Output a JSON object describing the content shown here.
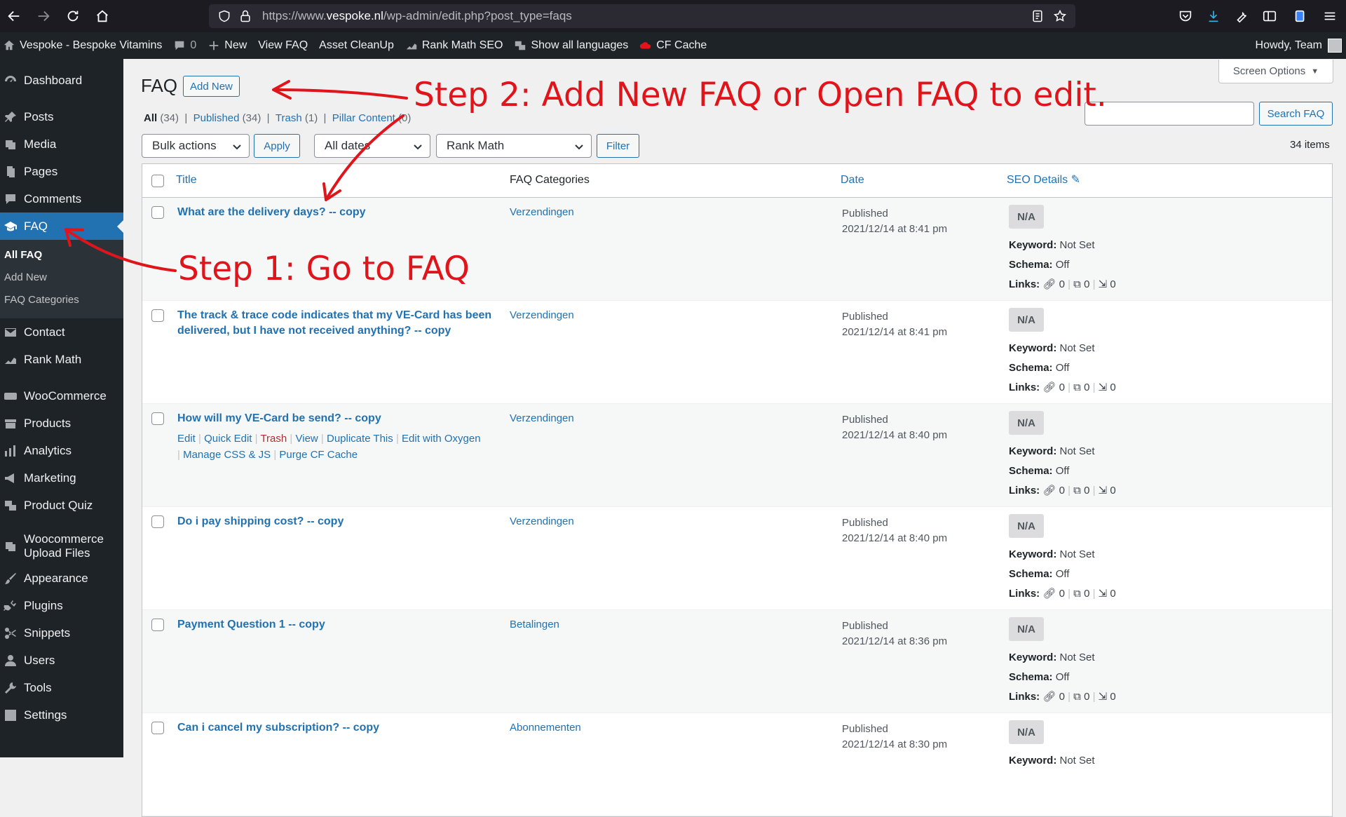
{
  "browser": {
    "url_prefix": "https://www.",
    "url_host": "vespoke.nl",
    "url_path": "/wp-admin/edit.php?post_type=faqs"
  },
  "adminbar": {
    "site_name": "Vespoke - Bespoke Vitamins",
    "comments_count": "0",
    "new_label": "New",
    "view_faq": "View FAQ",
    "asset_cleanup": "Asset CleanUp",
    "rank_math_seo": "Rank Math SEO",
    "show_languages": "Show all languages",
    "cf_cache": "CF Cache",
    "howdy": "Howdy, Team"
  },
  "sidebar": {
    "dashboard": "Dashboard",
    "posts": "Posts",
    "media": "Media",
    "pages": "Pages",
    "comments": "Comments",
    "faq": "FAQ",
    "all_faq": "All FAQ",
    "add_new": "Add New",
    "faq_categories": "FAQ Categories",
    "contact": "Contact",
    "rank_math": "Rank Math",
    "woocommerce": "WooCommerce",
    "products": "Products",
    "analytics": "Analytics",
    "marketing": "Marketing",
    "product_quiz": "Product Quiz",
    "wc_upload_1": "Woocommerce",
    "wc_upload_2": "Upload Files",
    "appearance": "Appearance",
    "plugins": "Plugins",
    "snippets": "Snippets",
    "users": "Users",
    "tools": "Tools",
    "settings": "Settings"
  },
  "page": {
    "title": "FAQ",
    "add_new": "Add New",
    "screen_options": "Screen Options",
    "filters": {
      "all": "All",
      "all_count": " (34)",
      "published": "Published",
      "published_count": " (34)",
      "trash": "Trash",
      "trash_count": " (1)",
      "pillar": "Pillar Content",
      "pillar_count": " (0)",
      "sep": "  |  "
    },
    "search_button": "Search FAQ",
    "bulk_actions": "Bulk actions",
    "apply": "Apply",
    "all_dates": "All dates",
    "rank_math": "Rank Math",
    "filter": "Filter",
    "items_count": "34 items"
  },
  "table": {
    "col_title": "Title",
    "col_categories": "FAQ Categories",
    "col_date": "Date",
    "col_seo": "SEO Details",
    "seo_na": "N/A",
    "keyword_label": "Keyword:",
    "keyword_value": " Not Set",
    "schema_label": "Schema:",
    "schema_value": " Off",
    "links_label": "Links:",
    "link_count": "0",
    "row_actions": {
      "edit": "Edit",
      "quick_edit": "Quick Edit",
      "trash": "Trash",
      "view": "View",
      "duplicate": "Duplicate This",
      "oxygen": "Edit with Oxygen",
      "manage_css": "Manage CSS & JS",
      "purge": "Purge CF Cache"
    },
    "rows": [
      {
        "title": "What are the delivery days? -- copy",
        "category": "Verzendingen",
        "status": "Published",
        "date": "2021/12/14 at 8:41 pm"
      },
      {
        "title": "The track & trace code indicates that my VE-Card has been delivered, but I have not received anything? -- copy",
        "category": "Verzendingen",
        "status": "Published",
        "date": "2021/12/14 at 8:41 pm"
      },
      {
        "title": "How will my VE-Card be send? -- copy",
        "category": "Verzendingen",
        "status": "Published",
        "date": "2021/12/14 at 8:40 pm"
      },
      {
        "title": "Do i pay shipping cost? -- copy",
        "category": "Verzendingen",
        "status": "Published",
        "date": "2021/12/14 at 8:40 pm"
      },
      {
        "title": "Payment Question 1 -- copy",
        "category": "Betalingen",
        "status": "Published",
        "date": "2021/12/14 at 8:36 pm"
      },
      {
        "title": "Can i cancel my subscription? -- copy",
        "category": "Abonnementen",
        "status": "Published",
        "date": "2021/12/14 at 8:30 pm"
      }
    ]
  },
  "annotations": {
    "step1": "Step 1: Go to FAQ",
    "step2": "Step 2: Add New FAQ or Open FAQ to edit.",
    "color": "#e0151b"
  }
}
